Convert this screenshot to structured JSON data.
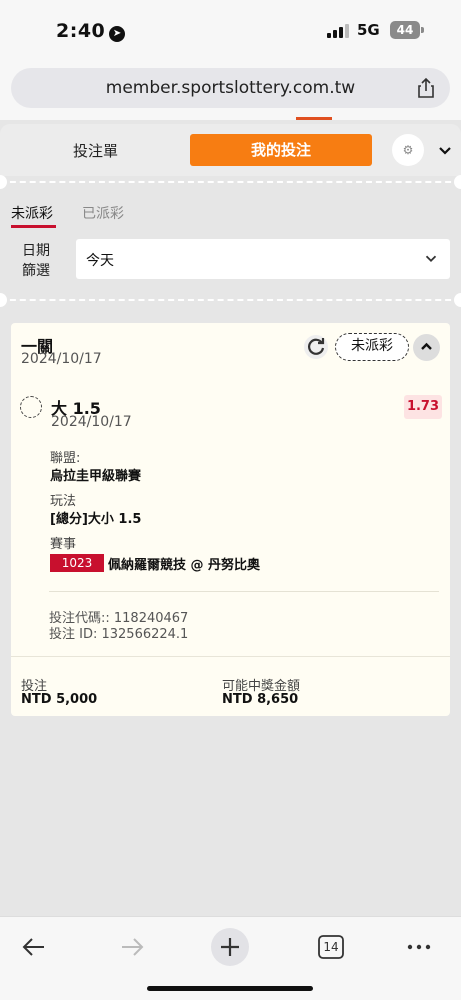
{
  "status_bar": {
    "time": "2:40",
    "network": "5G",
    "battery": "44"
  },
  "browser": {
    "url": "member.sportslottery.com.tw",
    "tab_count": "14"
  },
  "header_tabs": {
    "bet_slip": "投注單",
    "my_bets": "我的投注"
  },
  "subtabs": {
    "unsettled": "未派彩",
    "settled": "已派彩"
  },
  "date_filter": {
    "label": "日期篩選",
    "value": "今天"
  },
  "bet": {
    "type": "一關",
    "date": "2024/10/17",
    "status": "未派彩",
    "selection": {
      "name": "大 1.5",
      "date": "2024/10/17",
      "odds": "1.73"
    },
    "league_label": "聯盟:",
    "league": "烏拉圭甲級聯賽",
    "market_label": "玩法",
    "market": "[總分]大小 1.5",
    "event_label": "賽事",
    "event_code": "1023",
    "event_name": "佩納羅爾競技 @ 丹努比奧",
    "bet_code": "投注代碼:: 118240467",
    "bet_id": "投注 ID: 132566224.1",
    "stake_label": "投注",
    "stake": "NTD 5,000",
    "payout_label": "可能中獎金額",
    "payout": "NTD 8,650"
  }
}
